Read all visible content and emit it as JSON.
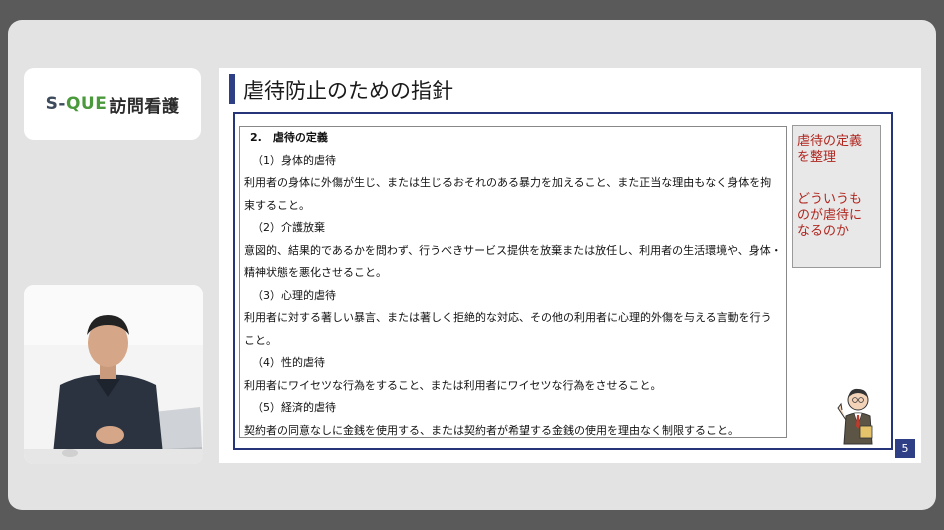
{
  "logo": {
    "part1": "S-",
    "part2": "QUE",
    "part3": "訪問看護"
  },
  "slide": {
    "title": "虐待防止のための指針",
    "page_number": "5",
    "content": {
      "heading": "2.　虐待の定義",
      "items": [
        {
          "label": "（1）身体的虐待",
          "lines": [
            "利用者の身体に外傷が生じ、または生じるおそれのある暴力を加えること、また正当な理由もなく身体を拘",
            "束すること。"
          ]
        },
        {
          "label": "（2）介護放棄",
          "lines": [
            "意図的、結果的であるかを問わず、行うべきサービス提供を放棄または放任し、利用者の生活環境や、身体・",
            "精神状態を悪化させること。"
          ]
        },
        {
          "label": "（3）心理的虐待",
          "lines": [
            "利用者に対する著しい暴言、または著しく拒絶的な対応、その他の利用者に心理的外傷を与える言動を行う",
            "こと。"
          ]
        },
        {
          "label": "（4）性的虐待",
          "lines": [
            "利用者にワイセツな行為をすること、または利用者にワイセツな行為をさせること。"
          ]
        },
        {
          "label": "（5）経済的虐待",
          "lines": [
            "契約者の同意なしに金銭を使用する、または契約者が希望する金銭の使用を理由なく制限すること。"
          ]
        }
      ]
    },
    "side_note": {
      "line1": "虐待の定義",
      "line2": "を整理",
      "line3": "どういうも",
      "line4": "のが虐待に",
      "line5": "なるのか"
    }
  },
  "colors": {
    "accent": "#2f3f86",
    "side_text": "#b0261f",
    "logo_green": "#4a9a3c"
  }
}
